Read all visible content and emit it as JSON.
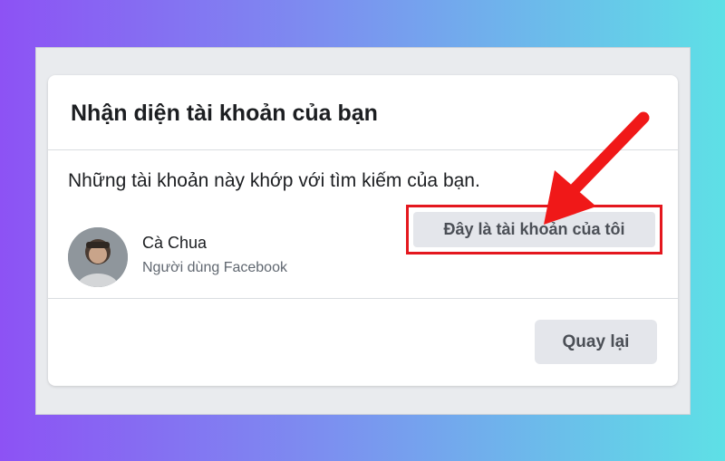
{
  "dialog": {
    "title": "Nhận diện tài khoản của bạn",
    "message": "Những tài khoản này khớp với tìm kiếm của bạn."
  },
  "account": {
    "name": "Cà Chua",
    "subtitle": "Người dùng Facebook",
    "button_label": "Đây là tài khoản của tôi"
  },
  "footer": {
    "back_label": "Quay lại"
  },
  "annotation": {
    "icon": "red-arrow-icon",
    "highlight_color": "#e4171e"
  },
  "colors": {
    "background_gradient_start": "#8d52f4",
    "background_gradient_end": "#5ee0e6",
    "button_bg": "#e4e6eb",
    "card_bg": "#ffffff"
  }
}
